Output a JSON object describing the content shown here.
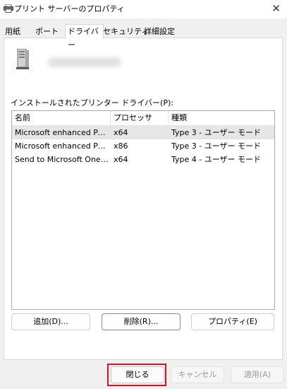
{
  "window": {
    "title": "プリント サーバーのプロパティ",
    "close_glyph": "✕"
  },
  "tabs": [
    {
      "label": "用紙"
    },
    {
      "label": "ポート"
    },
    {
      "label": "ドライバー"
    },
    {
      "label": "セキュリティ"
    },
    {
      "label": "詳細設定"
    }
  ],
  "driver_tab": {
    "section_label": "インストールされたプリンター ドライバー(P):",
    "columns": [
      "名前",
      "プロセッサ",
      "種類"
    ],
    "rows": [
      {
        "name": "Microsoft enhanced Point...",
        "processor": "x64",
        "type": "Type 3 - ユーザー モード"
      },
      {
        "name": "Microsoft enhanced Point...",
        "processor": "x86",
        "type": "Type 3 - ユーザー モード"
      },
      {
        "name": "Send to Microsoft OneN...",
        "processor": "x64",
        "type": "Type 4 - ユーザー モード"
      }
    ],
    "buttons": {
      "add": "追加(D)...",
      "remove": "削除(R)...",
      "properties": "プロパティ(E)"
    }
  },
  "footer": {
    "close": "閉じる",
    "cancel": "キャンセル",
    "apply": "適用(A)"
  },
  "colors": {
    "highlight": "#e0121b",
    "selected_row": "#e6e6e6"
  }
}
